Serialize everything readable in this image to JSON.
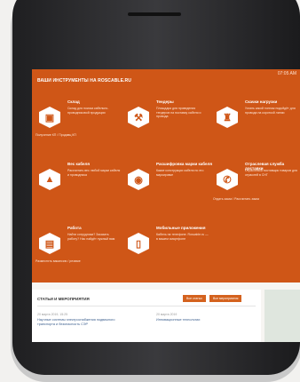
{
  "status": "07:05 AM",
  "hero": {
    "title": "ВАШИ ИНСТРУМЕНТЫ НА ROSCABLE.RU",
    "tiles": [
      {
        "title": "Склад",
        "desc": "Склад для поиска кабельно-проводниковой продукции",
        "link": "Получение КП / Продавц КП"
      },
      {
        "title": "Тендеры",
        "desc": "Площадка для проведения тендеров на поставку кабеля и провода",
        "link": ""
      },
      {
        "title": "Скачки нагрузки",
        "desc": "Узнать какой тоннаж подойдёт для провода на короткой линии",
        "link": ""
      },
      {
        "title": "Вес кабеля",
        "desc": "Рассчитать вес любой марки кабеля и проводника",
        "link": ""
      },
      {
        "title": "Расшифровка марки кабеля",
        "desc": "Какие конструкции кабеля по его маркировке",
        "link": ""
      },
      {
        "title": "Отраслевая служба доставки",
        "desc": "Отраслевой поставщик товаров для отраслей в СНГ",
        "link": "Отдать заказ / Рассчитать заказ"
      },
      {
        "title": "Работа",
        "desc": "Найти сотрудника? Заказать работу? Нас найдёт нужный вам",
        "link": "Разместить вакансию / резюме"
      },
      {
        "title": "Мобильные приложения",
        "desc": "Кабель на телефоне. Roscable.ru — в вашем смартфоне",
        "link": ""
      }
    ]
  },
  "news": {
    "title": "СТАТЬИ И МЕРОПРИЯТИЯ",
    "btn_articles": "Все статьи",
    "btn_events": "Все мероприятия",
    "items": [
      {
        "date": "20 марта 2019, 15:25",
        "title": "Научные системы электроснабжения подвижного транспорта и безопасность СЭР"
      },
      {
        "date": "20 марта 2019",
        "title": "Инновационные технологии"
      }
    ]
  }
}
